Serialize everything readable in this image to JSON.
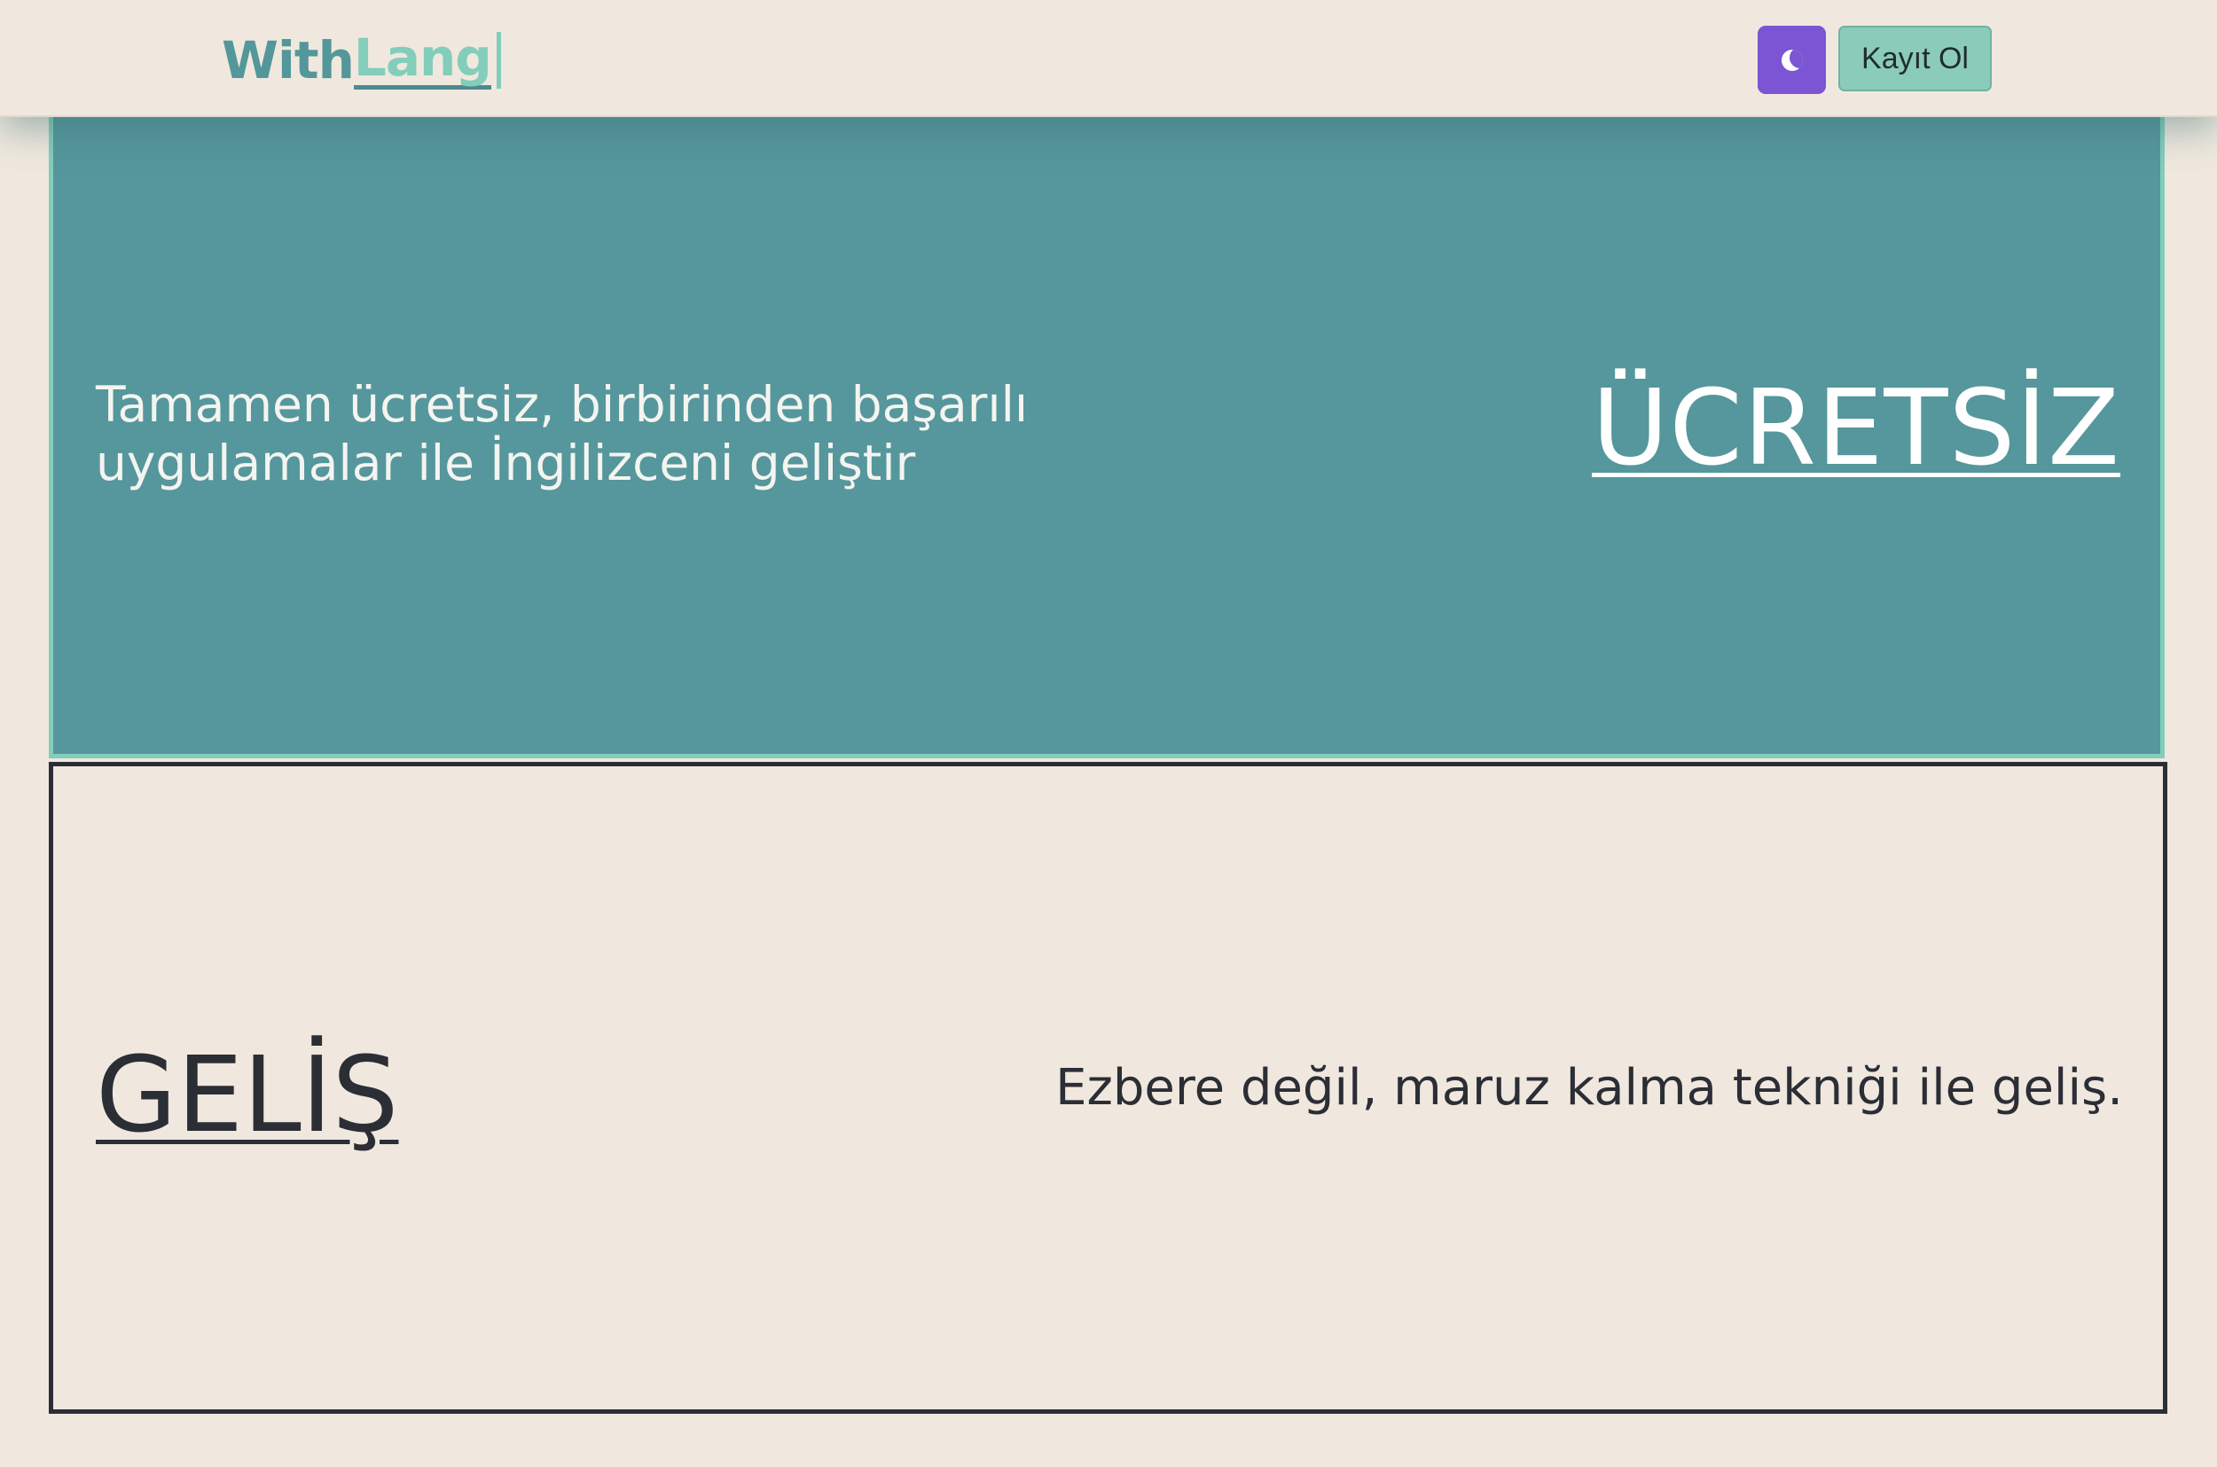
{
  "header": {
    "logo_part1": "With",
    "logo_part2": "Lang",
    "theme_toggle_icon": "moon-icon",
    "signup_label": "Kayıt Ol"
  },
  "sections": {
    "free": {
      "description": "Tamamen ücretsiz, birbirinden başarılı uygulamalar ile İngilizceni geliştir",
      "title": "ÜCRETSİZ"
    },
    "development": {
      "title": "GELİŞ",
      "description": "Ezbere değil, maruz kalma tekniği ile geliş."
    }
  },
  "colors": {
    "background": "#f0e8de",
    "teal": "#55979c",
    "mint": "#83cdbb",
    "purple": "#7b55d3",
    "dark": "#2b2e35"
  }
}
